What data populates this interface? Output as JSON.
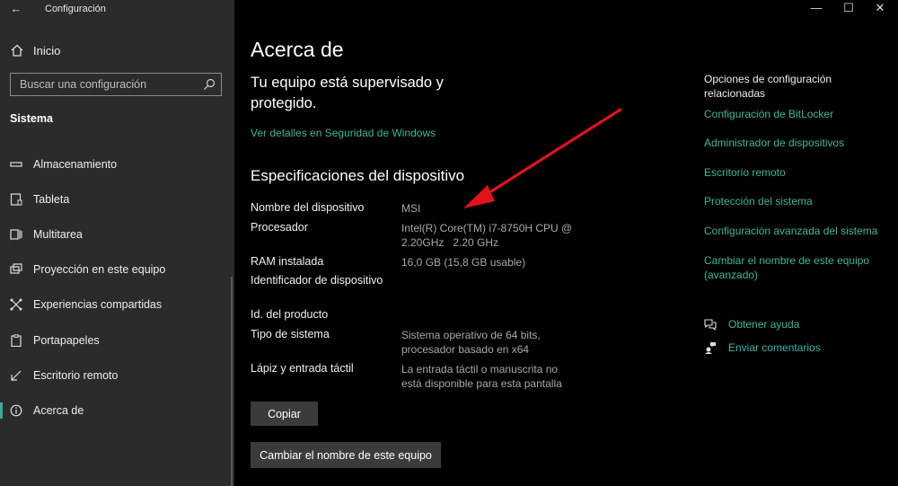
{
  "window": {
    "app_title": "Configuración",
    "back_icon": "arrow-left-icon",
    "minimize_glyph": "—",
    "maximize_glyph": "☐",
    "close_glyph": "✕"
  },
  "sidebar": {
    "home_label": "Inicio",
    "search_placeholder": "Buscar una configuración",
    "section_title": "Sistema",
    "items": [
      {
        "label": "Almacenamiento",
        "icon": "storage-icon"
      },
      {
        "label": "Tableta",
        "icon": "tablet-icon"
      },
      {
        "label": "Multitarea",
        "icon": "multitask-icon"
      },
      {
        "label": "Proyección en este equipo",
        "icon": "projection-icon"
      },
      {
        "label": "Experiencias compartidas",
        "icon": "shared-experiences-icon"
      },
      {
        "label": "Portapapeles",
        "icon": "clipboard-icon"
      },
      {
        "label": "Escritorio remoto",
        "icon": "remote-desktop-icon"
      },
      {
        "label": "Acerca de",
        "icon": "info-icon",
        "active": true
      }
    ]
  },
  "main": {
    "title": "Acerca de",
    "protection_status": "Tu equipo está supervisado y protegido.",
    "security_link": "Ver detalles en Seguridad de Windows",
    "specs_title": "Especificaciones del dispositivo",
    "specs": [
      {
        "label": "Nombre del dispositivo",
        "value": "MSI"
      },
      {
        "label": "Procesador",
        "value": "Intel(R) Core(TM) i7-8750H CPU @ 2.20GHz   2.20 GHz"
      },
      {
        "label": "RAM instalada",
        "value": "16,0 GB (15,8 GB usable)"
      },
      {
        "label": "Identificador de dispositivo",
        "value": ""
      },
      {
        "label": "Id. del producto",
        "value": ""
      },
      {
        "label": "Tipo de sistema",
        "value": "Sistema operativo de 64 bits, procesador basado en x64"
      },
      {
        "label": "Lápiz y entrada táctil",
        "value": "La entrada táctil o manuscrita no está disponible para esta pantalla"
      }
    ],
    "copy_button": "Copiar",
    "rename_button": "Cambiar el nombre de este equipo"
  },
  "related": {
    "title": "Opciones de configuración relacionadas",
    "links": [
      "Configuración de BitLocker",
      "Administrador de dispositivos",
      "Escritorio remoto",
      "Protección del sistema",
      "Configuración avanzada del sistema",
      "Cambiar el nombre de este equipo (avanzado)"
    ],
    "help": [
      {
        "label": "Obtener ayuda",
        "icon": "help-chat-icon"
      },
      {
        "label": "Enviar comentarios",
        "icon": "feedback-icon"
      }
    ]
  },
  "colors": {
    "accent": "#3fb59d",
    "sidebar_bg": "#2b2b2b",
    "main_bg": "#000000",
    "annotation_arrow": "#e0141a"
  }
}
